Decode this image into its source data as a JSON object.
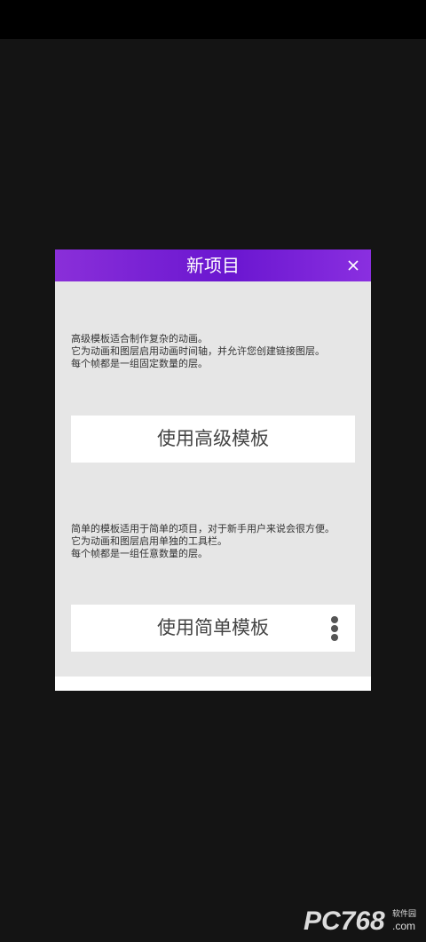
{
  "dialog": {
    "title": "新项目",
    "advanced": {
      "description_lines": [
        "高级模板适合制作复杂的动画。",
        "它为动画和图层启用动画时间轴，并允许您创建链接图层。",
        "每个帧都是一组固定数量的层。"
      ],
      "button_label": "使用高级模板"
    },
    "simple": {
      "description_lines": [
        "简单的模板适用于简单的项目，对于新手用户来说会很方便。",
        "它为动画和图层启用单独的工具栏。",
        "每个帧都是一组任意数量的层。"
      ],
      "button_label": "使用简单模板"
    }
  },
  "icons": {
    "close": "close-icon",
    "more": "more-vertical-icon"
  },
  "watermark": {
    "logo_text": "PC768",
    "sub_text": ".com",
    "tag_text": "软件园"
  },
  "colors": {
    "header_gradient_start": "#8a2fd9",
    "header_gradient_mid": "#6a16d0",
    "dialog_bg": "#e6e6e6",
    "page_bg": "#141414",
    "button_bg": "#ffffff"
  }
}
